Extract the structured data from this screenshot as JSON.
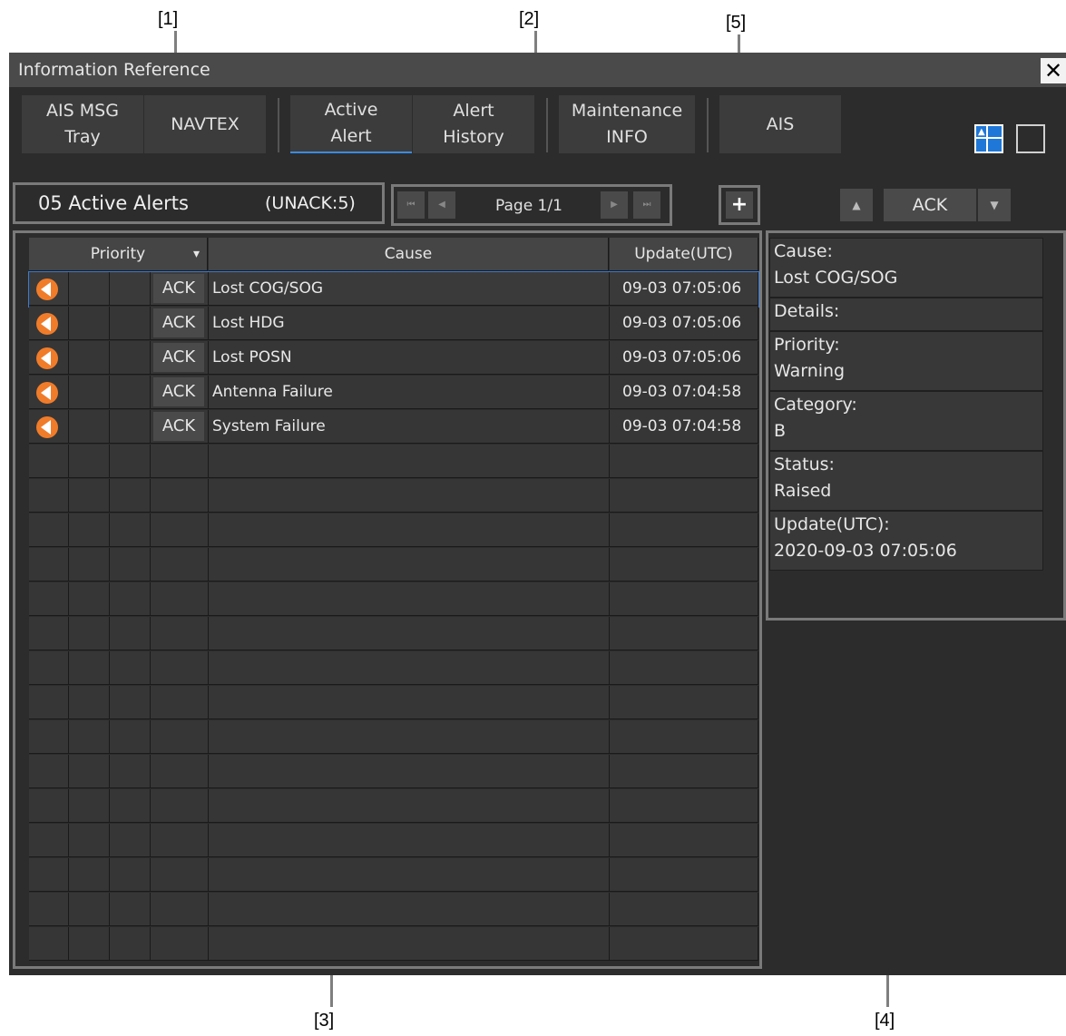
{
  "callouts": [
    "[1]",
    "[2]",
    "[3]",
    "[4]",
    "[5]"
  ],
  "window": {
    "title": "Information Reference",
    "close_label": "✕"
  },
  "tabs": [
    {
      "label": "AIS MSG\nTray"
    },
    {
      "label": "NAVTEX"
    },
    {
      "label": "Active\nAlert"
    },
    {
      "label": "Alert\nHistory"
    },
    {
      "label": "Maintenance\nINFO"
    },
    {
      "label": "AIS"
    }
  ],
  "summary": {
    "count_text": "05 Active Alerts",
    "unack_text": "(UNACK:5)"
  },
  "pager": {
    "first": "⏮",
    "prev": "◀",
    "page_text": "Page 1/1",
    "next": "▶",
    "last": "⏭"
  },
  "plus_label": "+",
  "ack_controls": {
    "up": "▲",
    "ack_label": "ACK",
    "down": "▼"
  },
  "table": {
    "headers": {
      "priority": "Priority",
      "priority_arrow": "▾",
      "cause": "Cause",
      "update": "Update(UTC)"
    },
    "rows": [
      {
        "ack": "ACK",
        "cause": "Lost COG/SOG",
        "update": "09-03 07:05:06"
      },
      {
        "ack": "ACK",
        "cause": "Lost HDG",
        "update": "09-03 07:05:06"
      },
      {
        "ack": "ACK",
        "cause": "Lost POSN",
        "update": "09-03 07:05:06"
      },
      {
        "ack": "ACK",
        "cause": "Antenna Failure",
        "update": "09-03 07:04:58"
      },
      {
        "ack": "ACK",
        "cause": "System Failure",
        "update": "09-03 07:04:58"
      }
    ]
  },
  "detail": {
    "cause_label": "Cause:",
    "cause_value": "Lost COG/SOG",
    "details_label": "Details:",
    "priority_label": "Priority:",
    "priority_value": "Warning",
    "category_label": "Category:",
    "category_value": "B",
    "status_label": "Status:",
    "status_value": "Raised",
    "update_label": "Update(UTC):",
    "update_value": "2020-09-03 07:05:06"
  },
  "colors": {
    "warning_icon": "#f07c2a",
    "active_tab_underline": "#3a8be0",
    "selected_layout_icon": "#1f78d8"
  }
}
